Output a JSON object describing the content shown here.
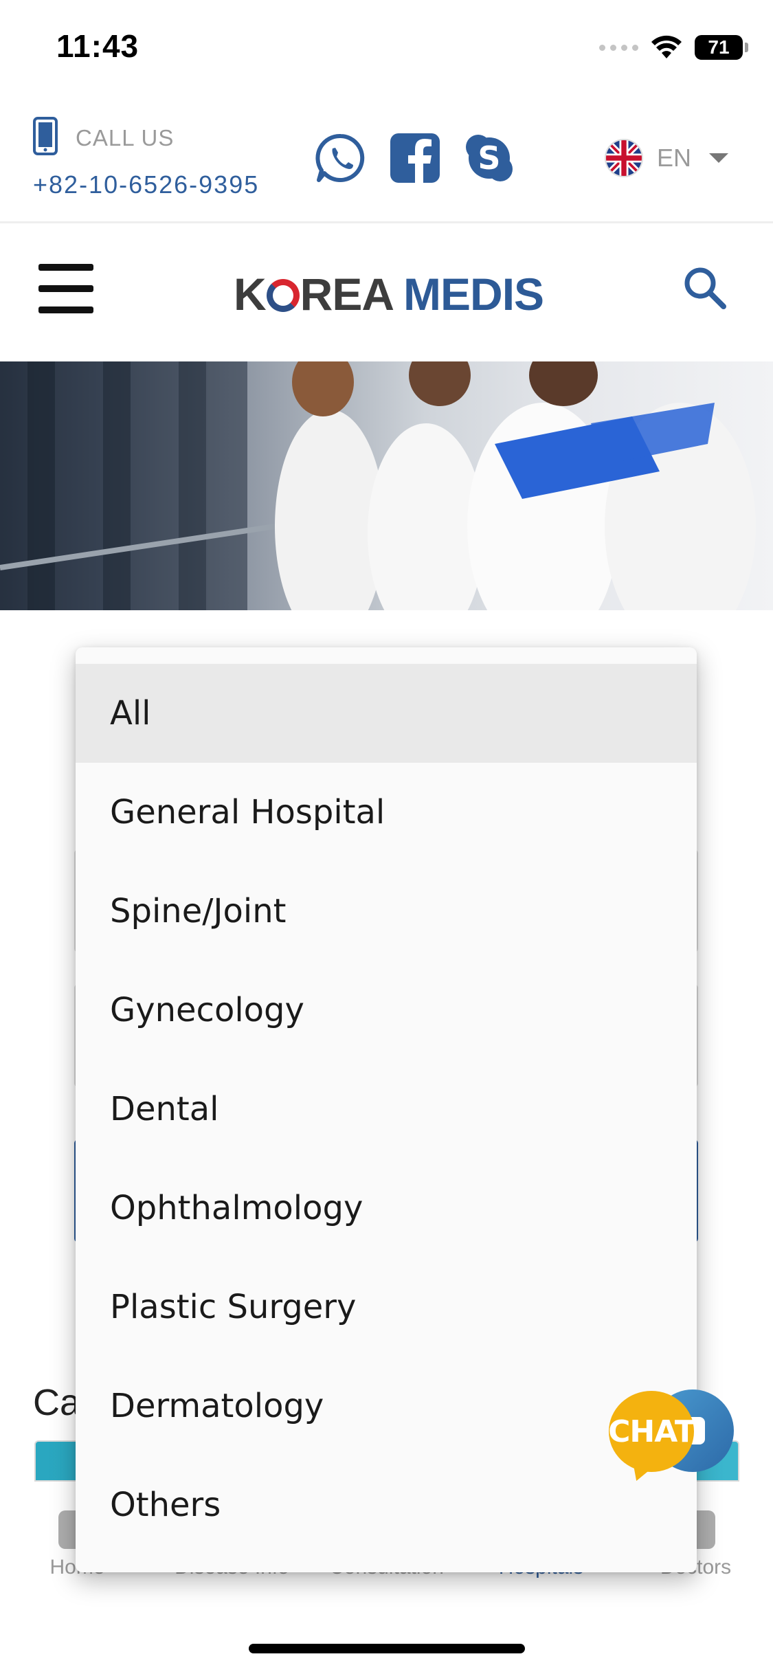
{
  "status_bar": {
    "time": "11:43",
    "battery": "71"
  },
  "contact": {
    "call_label": "CALL US",
    "phone_number": "+82-10-6526-9395",
    "social_icons": [
      "whatsapp-icon",
      "facebook-icon",
      "skype-icon"
    ],
    "language_code": "EN"
  },
  "header": {
    "logo_part1": "K",
    "logo_part2": "REA",
    "logo_part3": "MEDIS"
  },
  "page": {
    "section_heading_partial": "Ca"
  },
  "dropdown": {
    "selected": "All",
    "options": [
      "All",
      "General Hospital",
      "Spine/Joint",
      "Gynecology",
      "Dental",
      "Ophthalmology",
      "Plastic Surgery",
      "Dermatology",
      "Others"
    ]
  },
  "chat": {
    "label": "CHAT"
  },
  "tab_bar": {
    "tabs": [
      {
        "label": "Home",
        "active": false
      },
      {
        "label": "Disease Info",
        "active": false
      },
      {
        "label": "Consultation",
        "active": false
      },
      {
        "label": "Hospitals",
        "active": true
      },
      {
        "label": "Doctors",
        "active": false
      }
    ]
  },
  "colors": {
    "brand_blue": "#2f5e9c",
    "logo_red": "#d8262f",
    "chat_orange": "#f4b20f",
    "selected_bg": "#e9e9e9"
  }
}
